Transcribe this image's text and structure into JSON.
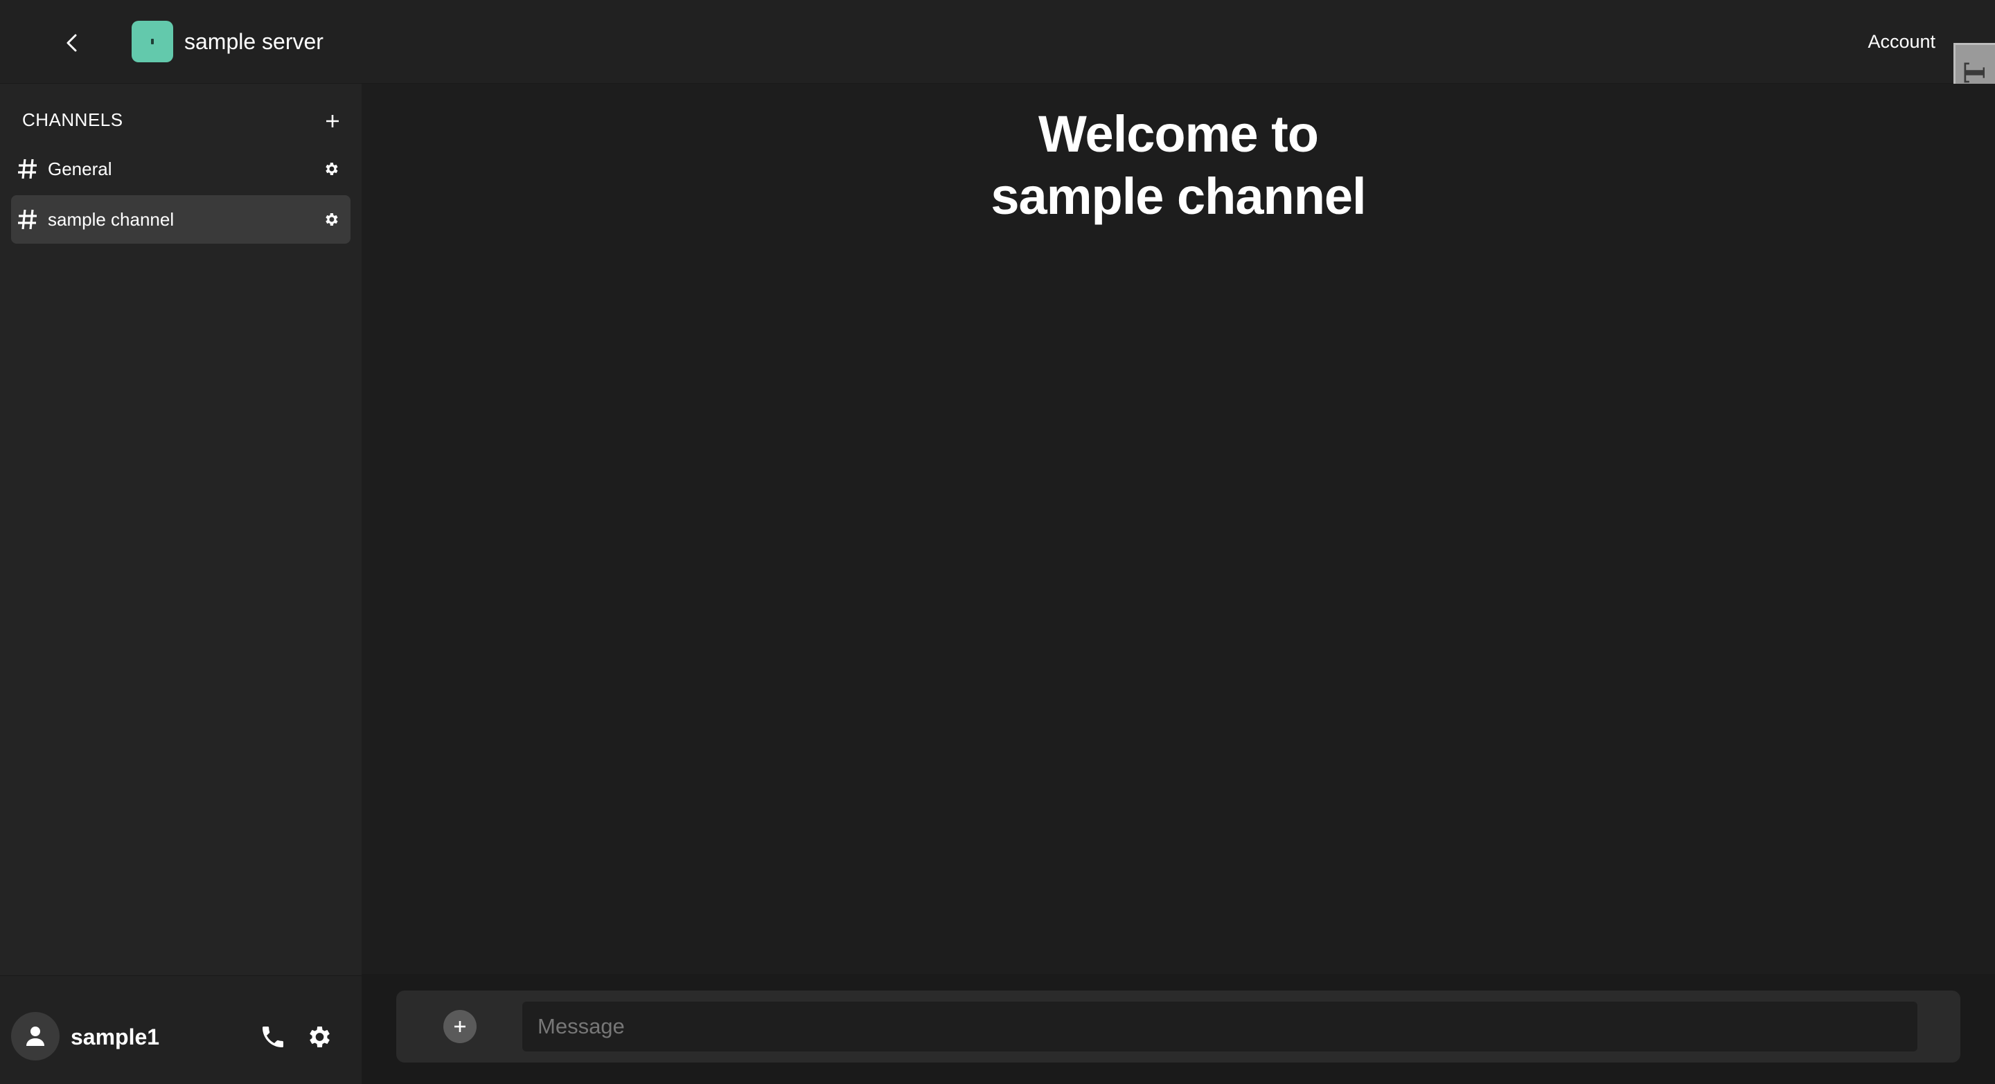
{
  "header": {
    "server_name": "sample server",
    "account_label": "Account",
    "edge_tab_label": "FDT",
    "server_icon_color": "#63c9ac"
  },
  "sidebar": {
    "section_title": "CHANNELS",
    "channels": [
      {
        "label": "General",
        "active": false
      },
      {
        "label": "sample channel",
        "active": true
      }
    ]
  },
  "user": {
    "username": "sample1"
  },
  "main": {
    "welcome_line1": "Welcome to",
    "welcome_line2": "sample channel"
  },
  "composer": {
    "placeholder": "Message"
  },
  "icons": {
    "back": "chevron-left-icon",
    "add": "plus-icon",
    "hash": "hash-icon",
    "gear": "gear-icon",
    "user": "user-icon",
    "phone": "phone-icon"
  },
  "colors": {
    "background": "#1d1d1d",
    "sidebar": "#242424",
    "active_channel": "#3a3a3a",
    "accent": "#63c9ac"
  }
}
